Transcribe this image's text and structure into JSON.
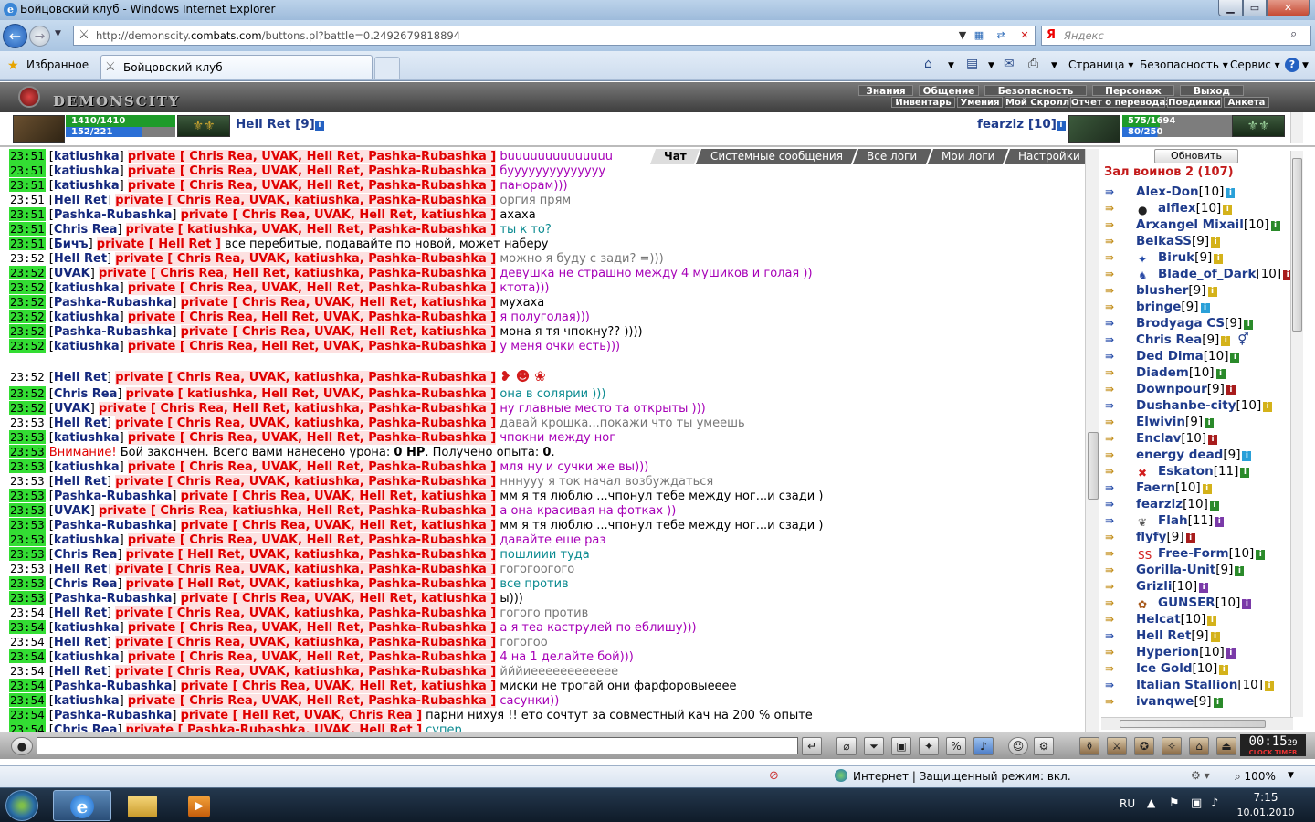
{
  "window": {
    "title": "Бойцовский клуб - Windows Internet Explorer"
  },
  "address": {
    "url_pre": "http://demonscity.",
    "url_host": "combats.com",
    "url_post": "/buttons.pl?battle=0.2492679818894",
    "search_placeholder": "Яндекс",
    "search_logo": "Я"
  },
  "favorites": {
    "label": "Избранное",
    "tab_title": "Бойцовский клуб"
  },
  "ietools": {
    "page": "Страница",
    "safety": "Безопасность",
    "service": "Сервис"
  },
  "game": {
    "logo": "DEMONSCITY",
    "menu_row1": [
      "Знания",
      "Общение",
      "Безопасность",
      "Персонаж",
      "Выход"
    ],
    "menu_row2": [
      "Инвентарь",
      "Умения",
      "Мой Скролл",
      "Отчет о переводах",
      "Поединки",
      "Анкета"
    ],
    "p1": {
      "name": "Hell Ret [9]",
      "hp": "1410/1410",
      "hp_ratio": 1.0,
      "mp": "152/221",
      "mp_ratio": 0.69
    },
    "p2": {
      "name": "fearziz [10]",
      "hp": "575/1694",
      "hp_ratio": 0.34,
      "mp": "80/250",
      "mp_ratio": 0.32
    }
  },
  "chat_tabs": [
    "Чат",
    "Системные сообщения",
    "Все логи",
    "Мои логи",
    "Настройки"
  ],
  "chat": [
    {
      "t": "23:51",
      "n": "katiushka",
      "p": "private [ Chris Rea, UVAK, Hell Ret, Pashka-Rubashka ]",
      "m": "buuuuuuuuuuuuuu",
      "c": "p"
    },
    {
      "t": "23:51",
      "n": "katiushka",
      "p": "private [ Chris Rea, UVAK, Hell Ret, Pashka-Rubashka ]",
      "m": "буууууууууууууу",
      "c": "p"
    },
    {
      "t": "23:51",
      "n": "katiushka",
      "p": "private [ Chris Rea, UVAK, Hell Ret, Pashka-Rubashka ]",
      "m": "панорам)))",
      "c": "p"
    },
    {
      "t": "23:51",
      "n": "Hell Ret",
      "p": "private [ Chris Rea, UVAK, katiushka, Pashka-Rubashka ]",
      "m": "оргия прям",
      "c": "g",
      "w": 1
    },
    {
      "t": "23:51",
      "n": "Pashka-Rubashka",
      "p": "private [ Chris Rea, UVAK, Hell Ret, katiushka ]",
      "m": "ахаха",
      "c": "b"
    },
    {
      "t": "23:51",
      "n": "Chris Rea",
      "p": "private [ katiushka, UVAK, Hell Ret, Pashka-Rubashka ]",
      "m": "ты к то?",
      "c": "t"
    },
    {
      "t": "23:51",
      "n": "Бичъ",
      "p": "private [ Hell Ret ]",
      "m": "все перебитые, подавайте по новой, может наберу",
      "c": "b"
    },
    {
      "t": "23:52",
      "n": "Hell Ret",
      "p": "private [ Chris Rea, UVAK, katiushka, Pashka-Rubashka ]",
      "m": "можно я буду с зади? =)))",
      "c": "g",
      "w": 1
    },
    {
      "t": "23:52",
      "n": "UVAK",
      "p": "private [ Chris Rea, Hell Ret, katiushka, Pashka-Rubashka ]",
      "m": "девушка не страшно между 4 мушиков и голая ))",
      "c": "p"
    },
    {
      "t": "23:52",
      "n": "katiushka",
      "p": "private [ Chris Rea, UVAK, Hell Ret, Pashka-Rubashka ]",
      "m": "ктота)))",
      "c": "p"
    },
    {
      "t": "23:52",
      "n": "Pashka-Rubashka",
      "p": "private [ Chris Rea, UVAK, Hell Ret, katiushka ]",
      "m": "мухаха",
      "c": "b"
    },
    {
      "t": "23:52",
      "n": "katiushka",
      "p": "private [ Chris Rea, Hell Ret, UVAK, Pashka-Rubashka ]",
      "m": "я полуголая)))",
      "c": "p"
    },
    {
      "t": "23:52",
      "n": "Pashka-Rubashka",
      "p": "private [ Chris Rea, UVAK, Hell Ret, katiushka ]",
      "m": "мона я тя чпокну?? ))))",
      "c": "b"
    },
    {
      "t": "23:52",
      "n": "katiushka",
      "p": "private [ Chris Rea, Hell Ret, UVAK, Pashka-Rubashka ]",
      "m": "у меня очки есть)))",
      "c": "p"
    }
  ],
  "chat2": [
    {
      "t": "23:52",
      "n": "Hell Ret",
      "p": "private [ Chris Rea, UVAK, katiushka, Pashka-Rubashka ]",
      "m": "",
      "c": "g",
      "w": 1,
      "smile": 1
    },
    {
      "t": "23:52",
      "n": "Chris Rea",
      "p": "private [ katiushka, Hell Ret, UVAK, Pashka-Rubashka ]",
      "m": "она в солярии )))",
      "c": "t"
    },
    {
      "t": "23:52",
      "n": "UVAK",
      "p": "private [ Chris Rea, Hell Ret, katiushka, Pashka-Rubashka ]",
      "m": "ну главные место та открыты )))",
      "c": "p"
    },
    {
      "t": "23:53",
      "n": "Hell Ret",
      "p": "private [ Chris Rea, UVAK, katiushka, Pashka-Rubashka ]",
      "m": "давай крошка...покажи что ты умеешь",
      "c": "g",
      "w": 1
    },
    {
      "t": "23:53",
      "n": "katiushka",
      "p": "private [ Chris Rea, UVAK, Hell Ret, Pashka-Rubashka ]",
      "m": "чпокни между ног",
      "c": "p"
    },
    {
      "t": "23:53",
      "sys": 1,
      "warn": "Внимание!",
      "m1": "Бой закончен. Всего вами нанесено урона: ",
      "v1": "0 HP",
      "m2": ". Получено опыта: ",
      "v2": "0",
      "m3": "."
    },
    {
      "t": "23:53",
      "n": "katiushka",
      "p": "private [ Chris Rea, UVAK, Hell Ret, Pashka-Rubashka ]",
      "m": "мля ну и сучки же вы)))",
      "c": "p"
    },
    {
      "t": "23:53",
      "n": "Hell Ret",
      "p": "private [ Chris Rea, UVAK, katiushka, Pashka-Rubashka ]",
      "m": "нннууу я ток начал возбуждаться",
      "c": "g",
      "w": 1
    },
    {
      "t": "23:53",
      "n": "Pashka-Rubashka",
      "p": "private [ Chris Rea, UVAK, Hell Ret, katiushka ]",
      "m": "мм я тя люблю ...чпонул тебе между ног...и сзади )",
      "c": "b"
    },
    {
      "t": "23:53",
      "n": "UVAK",
      "p": "private [ Chris Rea, katiushka, Hell Ret, Pashka-Rubashka ]",
      "m": "а она красивая на фотках ))",
      "c": "p"
    },
    {
      "t": "23:53",
      "n": "Pashka-Rubashka",
      "p": "private [ Chris Rea, UVAK, Hell Ret, katiushka ]",
      "m": "мм я тя люблю ...чпонул тебе между ног...и сзади )",
      "c": "b"
    },
    {
      "t": "23:53",
      "n": "katiushka",
      "p": "private [ Chris Rea, UVAK, Hell Ret, Pashka-Rubashka ]",
      "m": "давайте еше раз",
      "c": "p"
    },
    {
      "t": "23:53",
      "n": "Chris Rea",
      "p": "private [ Hell Ret, UVAK, katiushka, Pashka-Rubashka ]",
      "m": "пошлиии туда",
      "c": "t"
    },
    {
      "t": "23:53",
      "n": "Hell Ret",
      "p": "private [ Chris Rea, UVAK, katiushka, Pashka-Rubashka ]",
      "m": "гогогоогого",
      "c": "g",
      "w": 1
    },
    {
      "t": "23:53",
      "n": "Chris Rea",
      "p": "private [ Hell Ret, UVAK, katiushka, Pashka-Rubashka ]",
      "m": "все против",
      "c": "t"
    },
    {
      "t": "23:53",
      "n": "Pashka-Rubashka",
      "p": "private [ Chris Rea, UVAK, Hell Ret, katiushka ]",
      "m": "ы)))",
      "c": "b"
    },
    {
      "t": "23:54",
      "n": "Hell Ret",
      "p": "private [ Chris Rea, UVAK, katiushka, Pashka-Rubashka ]",
      "m": "гогого против",
      "c": "g",
      "w": 1
    },
    {
      "t": "23:54",
      "n": "katiushka",
      "p": "private [ Chris Rea, UVAK, Hell Ret, Pashka-Rubashka ]",
      "m": "а я теа каструлей по еблишу)))",
      "c": "p"
    },
    {
      "t": "23:54",
      "n": "Hell Ret",
      "p": "private [ Chris Rea, UVAK, katiushka, Pashka-Rubashka ]",
      "m": "гогогоо",
      "c": "g",
      "w": 1
    },
    {
      "t": "23:54",
      "n": "katiushka",
      "p": "private [ Chris Rea, UVAK, Hell Ret, Pashka-Rubashka ]",
      "m": "4 на 1 делайте бой)))",
      "c": "p"
    },
    {
      "t": "23:54",
      "n": "Hell Ret",
      "p": "private [ Chris Rea, UVAK, katiushka, Pashka-Rubashka ]",
      "m": "йййиееееееееееее",
      "c": "g",
      "w": 1
    },
    {
      "t": "23:54",
      "n": "Pashka-Rubashka",
      "p": "private [ Chris Rea, UVAK, Hell Ret, katiushka ]",
      "m": "миски не трогай они фарфоровыееее",
      "c": "b"
    },
    {
      "t": "23:54",
      "n": "katiushka",
      "p": "private [ Chris Rea, UVAK, Hell Ret, Pashka-Rubashka ]",
      "m": "сасунки))",
      "c": "p"
    },
    {
      "t": "23:54",
      "n": "Pashka-Rubashka",
      "p": "private [ Hell Ret, UVAK, Chris Rea ]",
      "m": "парни нихуя !! ето сочтут за совместный кач на 200 % опыте",
      "c": "b"
    },
    {
      "t": "23:54",
      "n": "Chris Rea",
      "p": "private [ Pashka-Rubashka, UVAK, Hell Ret ]",
      "m": "супер",
      "c": "t"
    }
  ],
  "panel": {
    "refresh": "Обновить",
    "hall": "Зал воинов 2 (107)",
    "players": [
      {
        "n": "Alex-Don",
        "l": "[10]",
        "a": "b",
        "i": "#2aa0d8"
      },
      {
        "n": "alflex",
        "l": "[10]",
        "a": "g",
        "i": "#d4b21a",
        "clan": "●",
        "cc": "#222"
      },
      {
        "n": "Arxangel Mixail",
        "l": "[10]",
        "a": "g",
        "i": "#2a8a2a"
      },
      {
        "n": "BelkaSS",
        "l": "[9]",
        "a": "g",
        "i": "#d4b21a"
      },
      {
        "n": "Biruk",
        "l": "[9]",
        "a": "g",
        "i": "#d4b21a",
        "clan": "✦",
        "cc": "#1f47a6"
      },
      {
        "n": "Blade_of_Dark",
        "l": "[10]",
        "a": "g",
        "i": "#a81c1c",
        "clan": "♞",
        "cc": "#2a4aa6"
      },
      {
        "n": "blusher",
        "l": "[9]",
        "a": "g",
        "i": "#d4b21a"
      },
      {
        "n": "bringe",
        "l": "[9]",
        "a": "g",
        "i": "#2aa0d8"
      },
      {
        "n": "Brodyaga CS",
        "l": "[9]",
        "a": "b",
        "i": "#2a8a2a"
      },
      {
        "n": "Chris Rea",
        "l": "[9]",
        "a": "b",
        "i": "#d4b21a",
        "extra": "⚥"
      },
      {
        "n": "Ded Dima",
        "l": "[10]",
        "a": "b",
        "i": "#2a8a2a"
      },
      {
        "n": "Diadem",
        "l": "[10]",
        "a": "g",
        "i": "#2a8a2a"
      },
      {
        "n": "Downpour",
        "l": "[9]",
        "a": "g",
        "i": "#a81c1c"
      },
      {
        "n": "Dushanbe-city",
        "l": "[10]",
        "a": "b",
        "i": "#d4b21a"
      },
      {
        "n": "Elwivin",
        "l": "[9]",
        "a": "g",
        "i": "#2a8a2a"
      },
      {
        "n": "Enclav",
        "l": "[10]",
        "a": "g",
        "i": "#a81c1c"
      },
      {
        "n": "energy dead",
        "l": "[9]",
        "a": "g",
        "i": "#2aa0d8"
      },
      {
        "n": "Eskaton",
        "l": "[11]",
        "a": "g",
        "i": "#2a8a2a",
        "clan": "✖",
        "cc": "#d21c1c"
      },
      {
        "n": "Faern",
        "l": "[10]",
        "a": "b",
        "i": "#d4b21a"
      },
      {
        "n": "fearziz",
        "l": "[10]",
        "a": "b",
        "i": "#2a8a2a"
      },
      {
        "n": "Flah",
        "l": "[11]",
        "a": "b",
        "i": "#7a3aa8",
        "clan": "❦",
        "cc": "#555"
      },
      {
        "n": "flyfy",
        "l": "[9]",
        "a": "g",
        "i": "#a81c1c"
      },
      {
        "n": "Free-Form",
        "l": "[10]",
        "a": "g",
        "i": "#2a8a2a",
        "clan": "SS",
        "cc": "#d21c1c"
      },
      {
        "n": "Gorilla-Unit",
        "l": "[9]",
        "a": "g",
        "i": "#2a8a2a"
      },
      {
        "n": "Grizli",
        "l": "[10]",
        "a": "g",
        "i": "#7a3aa8"
      },
      {
        "n": "GUNSER",
        "l": "[10]",
        "a": "g",
        "i": "#7a3aa8",
        "clan": "✿",
        "cc": "#a85a1c"
      },
      {
        "n": "Helcat",
        "l": "[10]",
        "a": "g",
        "i": "#d4b21a"
      },
      {
        "n": "Hell Ret",
        "l": "[9]",
        "a": "b",
        "i": "#d4b21a"
      },
      {
        "n": "Hyperion",
        "l": "[10]",
        "a": "g",
        "i": "#7a3aa8"
      },
      {
        "n": "Ice Gold",
        "l": "[10]",
        "a": "g",
        "i": "#d4b21a"
      },
      {
        "n": "Italian Stallion",
        "l": "[10]",
        "a": "b",
        "i": "#d4b21a"
      },
      {
        "n": "ivanqwe",
        "l": "[9]",
        "a": "g",
        "i": "#2a8a2a"
      }
    ]
  },
  "bottom": {
    "clock": "00:15",
    "clock_sec": "29",
    "clock_label": "CLOCK TIMER"
  },
  "status": {
    "zone": "Интернет | Защищенный режим: вкл.",
    "zoom": "100%"
  },
  "taskbar": {
    "lang": "RU",
    "time": "7:15",
    "date": "10.01.2010"
  }
}
